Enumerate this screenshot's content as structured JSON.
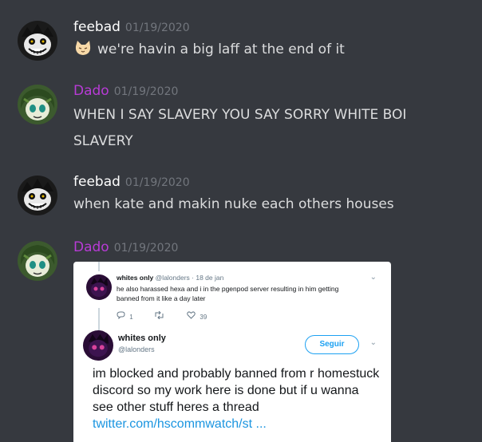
{
  "messages": [
    {
      "username": "feebad",
      "username_color": "#ffffff",
      "timestamp": "01/19/2020",
      "text": "we're havin a big laff at the end of it",
      "emoji": "cat-face-emoji"
    },
    {
      "username": "Dado",
      "username_color": "#b83bd6",
      "timestamp": "01/19/2020",
      "text": "WHEN I SAY SLAVERY YOU SAY SORRY WHITE BOI SLAVERY"
    },
    {
      "username": "feebad",
      "username_color": "#ffffff",
      "timestamp": "01/19/2020",
      "text": "when kate and makin nuke each others houses"
    },
    {
      "username": "Dado",
      "username_color": "#b83bd6",
      "timestamp": "01/19/2020"
    }
  ],
  "tweet": {
    "reply": {
      "name": "whites only",
      "handle_date": "@lalonders · 18 de jan",
      "text": "he also harassed hexa and i in the pgenpod server resulting in him getting banned from it like a day later",
      "reply_count": "1",
      "like_count": "39"
    },
    "main": {
      "name": "whites only",
      "handle": "@lalonders",
      "follow_label": "Seguir",
      "text": "im blocked and probably banned from r homestuck discord so my work here is done but if u wanna see other stuff heres a thread ",
      "link": "twitter.com/hscommwatch/st ..."
    }
  },
  "icons": [
    "avatar-feebad",
    "avatar-dado",
    "reply-icon",
    "retweet-icon",
    "like-icon",
    "chevron-down-icon"
  ]
}
